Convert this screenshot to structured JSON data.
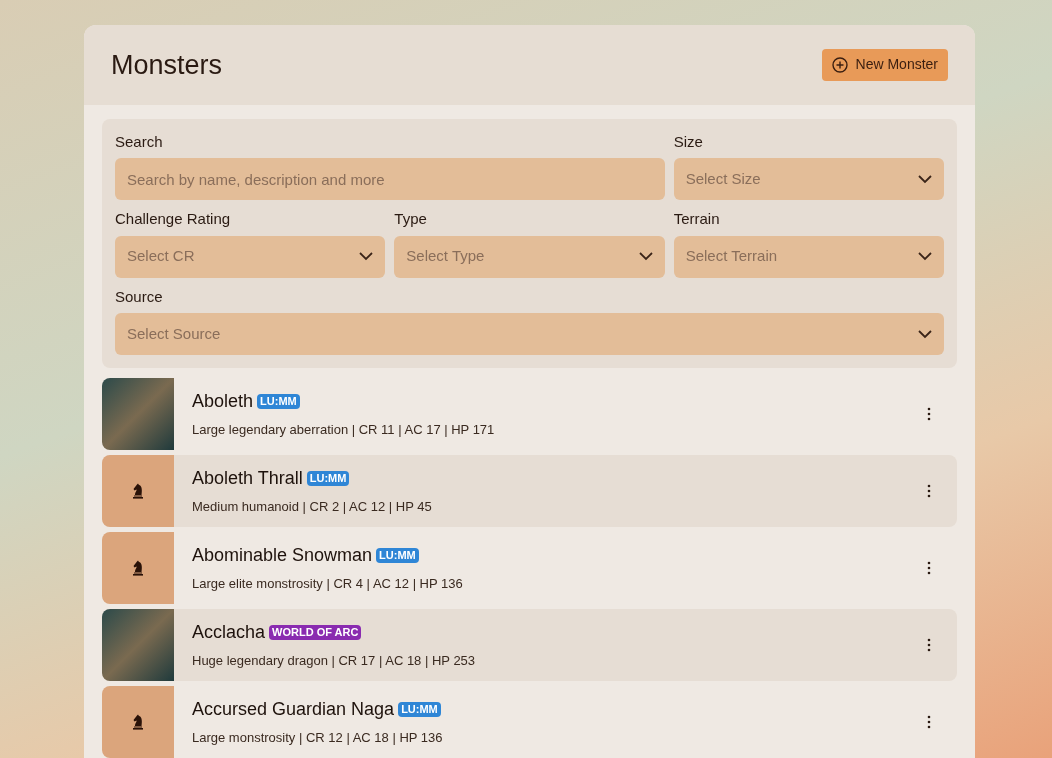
{
  "header": {
    "title": "Monsters",
    "new_button": "New Monster"
  },
  "filters": [
    {
      "kind": "text",
      "label": "Search",
      "placeholder": "Search by name, description and more"
    },
    {
      "kind": "select",
      "label": "Size",
      "placeholder": "Select Size"
    },
    {
      "kind": "select",
      "label": "Challenge Rating",
      "placeholder": "Select CR"
    },
    {
      "kind": "select",
      "label": "Type",
      "placeholder": "Select Type"
    },
    {
      "kind": "select",
      "label": "Terrain",
      "placeholder": "Select Terrain"
    },
    {
      "kind": "select",
      "label": "Source",
      "placeholder": "Select Source"
    }
  ],
  "monsters": [
    {
      "name": "Aboleth",
      "badge": "LU:MM",
      "color": "#2f86d6",
      "kind": "photo",
      "details": "Large legendary aberration | CR 11 | AC 17 | HP 171"
    },
    {
      "name": "Aboleth Thrall",
      "badge": "LU:MM",
      "color": "#2f86d6",
      "kind": "icon",
      "details": "Medium humanoid | CR 2 | AC 12 | HP 45"
    },
    {
      "name": "Abominable Snowman",
      "badge": "LU:MM",
      "color": "#2f86d6",
      "kind": "icon",
      "details": "Large elite monstrosity | CR 4 | AC 12 | HP 136"
    },
    {
      "name": "Acclacha",
      "badge": "WORLD OF ARC",
      "color": "#8a2bb0",
      "kind": "photo",
      "details": "Huge legendary dragon | CR 17 | AC 18 | HP 253"
    },
    {
      "name": "Accursed Guardian Naga",
      "badge": "LU:MM",
      "color": "#2f86d6",
      "kind": "icon",
      "details": "Large monstrosity | CR 12 | AC 18 | HP 136"
    }
  ]
}
